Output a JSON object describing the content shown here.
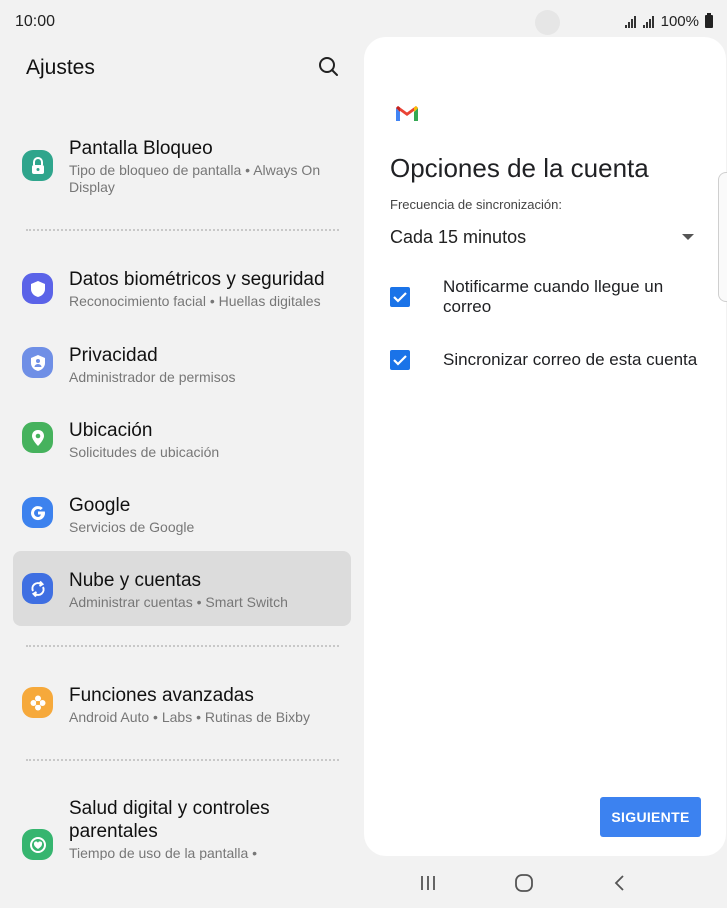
{
  "status_bar": {
    "time": "10:00",
    "battery": "100%",
    "icons": [
      "camera-cutout",
      "signal-icon",
      "signal-icon",
      "battery-icon"
    ]
  },
  "settings": {
    "title": "Ajustes",
    "search_icon": "search-icon",
    "items": [
      {
        "title": "Pantalla Bloqueo",
        "subtitle": "Tipo de bloqueo de pantalla  •  Always On Display",
        "icon": "lock-icon",
        "color": "#2fa58c"
      },
      {
        "title": "Datos biométricos y seguridad",
        "subtitle": "Reconocimiento facial  •  Huellas digitales",
        "icon": "shield-icon",
        "color": "#5b63e8"
      },
      {
        "title": "Privacidad",
        "subtitle": "Administrador de permisos",
        "icon": "privacy-icon",
        "color": "#6f8fe6"
      },
      {
        "title": "Ubicación",
        "subtitle": "Solicitudes de ubicación",
        "icon": "location-icon",
        "color": "#46b25d"
      },
      {
        "title": "Google",
        "subtitle": "Servicios de Google",
        "icon": "google-icon",
        "color": "#3d82ee"
      },
      {
        "title": "Nube y cuentas",
        "subtitle": "Administrar cuentas  •  Smart Switch",
        "icon": "sync-icon",
        "color": "#3f6fe2"
      },
      {
        "title": "Funciones avanzadas",
        "subtitle": "Android Auto  •  Labs  •  Rutinas de Bixby",
        "icon": "advanced-features-icon",
        "color": "#f6a93b"
      },
      {
        "title": "Salud digital y controles parentales",
        "subtitle": "Tiempo de uso de la pantalla  •",
        "icon": "digital-wellbeing-icon",
        "color": "#36b56f"
      }
    ]
  },
  "account_options": {
    "logo": "gmail-logo",
    "title": "Opciones de la cuenta",
    "sync_frequency_label": "Frecuencia de sincronización:",
    "sync_frequency_value": "Cada 15 minutos",
    "checkboxes": [
      {
        "label": "Notificarme cuando llegue un correo",
        "checked": true
      },
      {
        "label": "Sincronizar correo de esta cuenta",
        "checked": true
      }
    ],
    "next_button": "SIGUIENTE",
    "accent_color": "#1a73e8"
  },
  "nav_bar": {
    "buttons": [
      "recent-apps-icon",
      "home-icon",
      "back-icon"
    ]
  }
}
